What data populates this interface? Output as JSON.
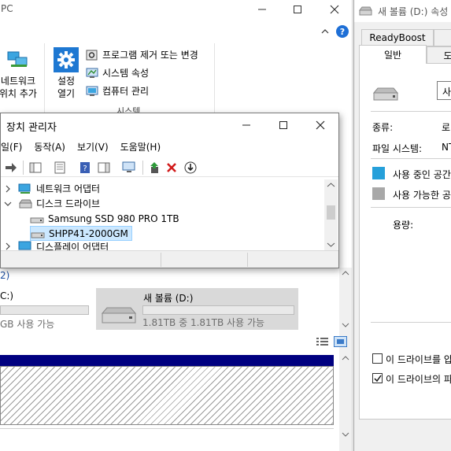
{
  "explorer": {
    "title_fragment": "PC",
    "ribbon": {
      "network": {
        "line1": "네트워크",
        "line2": "위치 추가"
      },
      "settings": {
        "line1": "설정",
        "line2": "열기"
      },
      "items": [
        {
          "label": "프로그램 제거 또는 변경",
          "icon": "program-uninstall-icon"
        },
        {
          "label": "시스템 속성",
          "icon": "system-properties-icon"
        },
        {
          "label": "컴퓨터 관리",
          "icon": "computer-management-icon"
        }
      ],
      "group_label": "시스템"
    },
    "section_label_fragment": "2)",
    "drive_c": {
      "name_fragment": "C:)",
      "free_fragment": "GB 사용 가능"
    },
    "drive_d": {
      "name": "새 볼륨 (D:)",
      "free": "1.81TB 중 1.81TB 사용 가능",
      "used_fraction": 0.0
    }
  },
  "device_manager": {
    "title": "장치 관리자",
    "menu": [
      "일(F)",
      "동작(A)",
      "보기(V)",
      "도움말(H)"
    ],
    "tree": [
      {
        "label": "네트워크 어댑터",
        "expanded": false,
        "level": 0,
        "icon": "network-adapter-icon"
      },
      {
        "label": "디스크 드라이브",
        "expanded": true,
        "level": 0,
        "icon": "disk-drive-icon"
      },
      {
        "label": "Samsung SSD 980 PRO 1TB",
        "level": 1,
        "icon": "disk-icon"
      },
      {
        "label": "SHPP41-2000GM",
        "level": 1,
        "icon": "disk-icon",
        "selected": true
      },
      {
        "label": "디스플레이 어댑터",
        "expanded": false,
        "level": 0,
        "icon": "display-adapter-icon"
      }
    ]
  },
  "properties": {
    "title": "새 볼륨 (D:) 속성",
    "tabs_top": [
      "ReadyBoost"
    ],
    "tabs_bottom": [
      "일반",
      "도"
    ],
    "name_fragment": "사",
    "type_label": "종류:",
    "type_value_fragment": "로",
    "fs_label": "파일 시스템:",
    "fs_value_fragment": "NT",
    "used_label": "사용 중인 공간",
    "free_label": "사용 가능한 공",
    "capacity_label": "용량:",
    "compress_label": "이 드라이브를 압",
    "index_label": "이 드라이브의 파",
    "compress_checked": false,
    "index_checked": true,
    "colors": {
      "used": "#26a0da",
      "free": "#a8a8a8"
    }
  }
}
